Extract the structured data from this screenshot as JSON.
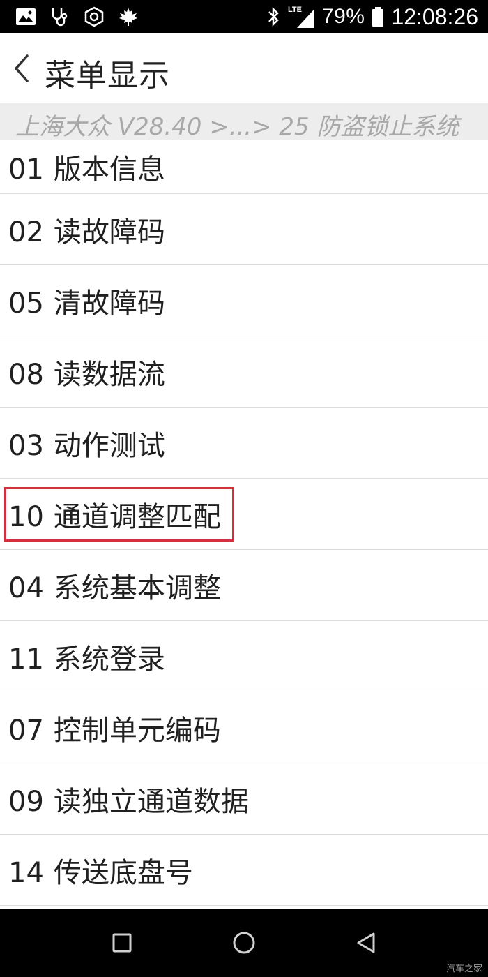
{
  "status_bar": {
    "icons_left": [
      "image-icon",
      "stethoscope-icon",
      "hexagon-nut-icon",
      "maple-leaf-icon"
    ],
    "bluetooth_icon": "bluetooth-icon",
    "network_label": "LTE",
    "battery_percent": "79%",
    "time": "12:08:26"
  },
  "header": {
    "back_icon": "chevron-left-icon",
    "title": "菜单显示"
  },
  "breadcrumb": {
    "text": "上海大众 V28.40 >...> 25 防盗锁止系统"
  },
  "menu": {
    "items": [
      {
        "code": "01",
        "label": "版本信息"
      },
      {
        "code": "02",
        "label": "读故障码"
      },
      {
        "code": "05",
        "label": "清故障码"
      },
      {
        "code": "08",
        "label": "读数据流"
      },
      {
        "code": "03",
        "label": "动作测试"
      },
      {
        "code": "10",
        "label": "通道调整匹配"
      },
      {
        "code": "04",
        "label": "系统基本调整"
      },
      {
        "code": "11",
        "label": "系统登录"
      },
      {
        "code": "07",
        "label": "控制单元编码"
      },
      {
        "code": "09",
        "label": "读独立通道数据"
      },
      {
        "code": "14",
        "label": "传送底盘号"
      }
    ],
    "highlight_color": "#d32f3f"
  },
  "nav_bar": {
    "recents_icon": "square-recents-icon",
    "home_icon": "circle-home-icon",
    "back_icon": "triangle-back-icon"
  },
  "watermark": "汽车之家"
}
